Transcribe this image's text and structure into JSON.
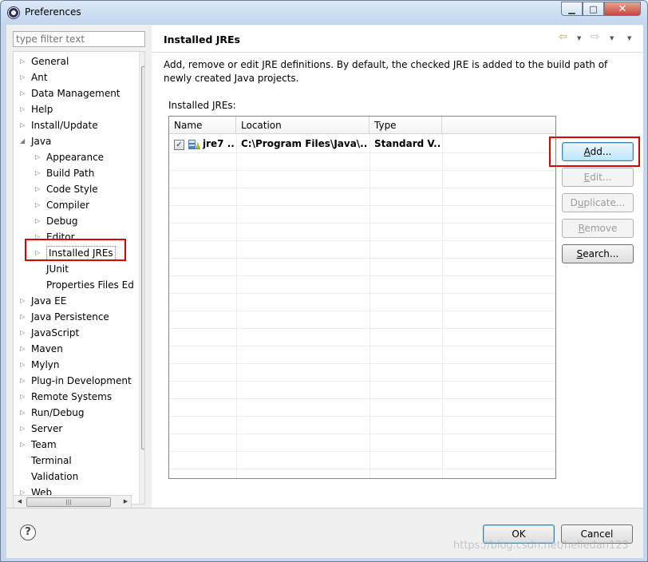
{
  "window": {
    "title": "Preferences"
  },
  "filter": {
    "placeholder": "type filter text"
  },
  "tree": {
    "items": [
      {
        "label": "General",
        "level": 0,
        "expand": "collapsed"
      },
      {
        "label": "Ant",
        "level": 0,
        "expand": "collapsed"
      },
      {
        "label": "Data Management",
        "level": 0,
        "expand": "collapsed"
      },
      {
        "label": "Help",
        "level": 0,
        "expand": "collapsed"
      },
      {
        "label": "Install/Update",
        "level": 0,
        "expand": "collapsed"
      },
      {
        "label": "Java",
        "level": 0,
        "expand": "expanded"
      },
      {
        "label": "Appearance",
        "level": 1,
        "expand": "collapsed"
      },
      {
        "label": "Build Path",
        "level": 1,
        "expand": "collapsed"
      },
      {
        "label": "Code Style",
        "level": 1,
        "expand": "collapsed"
      },
      {
        "label": "Compiler",
        "level": 1,
        "expand": "collapsed"
      },
      {
        "label": "Debug",
        "level": 1,
        "expand": "collapsed"
      },
      {
        "label": "Editor",
        "level": 1,
        "expand": "collapsed"
      },
      {
        "label": "Installed JREs",
        "level": 1,
        "expand": "collapsed",
        "selected": true
      },
      {
        "label": "JUnit",
        "level": 1,
        "expand": "none"
      },
      {
        "label": "Properties Files Ed",
        "level": 1,
        "expand": "none"
      },
      {
        "label": "Java EE",
        "level": 0,
        "expand": "collapsed"
      },
      {
        "label": "Java Persistence",
        "level": 0,
        "expand": "collapsed"
      },
      {
        "label": "JavaScript",
        "level": 0,
        "expand": "collapsed"
      },
      {
        "label": "Maven",
        "level": 0,
        "expand": "collapsed"
      },
      {
        "label": "Mylyn",
        "level": 0,
        "expand": "collapsed"
      },
      {
        "label": "Plug-in Development",
        "level": 0,
        "expand": "collapsed"
      },
      {
        "label": "Remote Systems",
        "level": 0,
        "expand": "collapsed"
      },
      {
        "label": "Run/Debug",
        "level": 0,
        "expand": "collapsed"
      },
      {
        "label": "Server",
        "level": 0,
        "expand": "collapsed"
      },
      {
        "label": "Team",
        "level": 0,
        "expand": "collapsed"
      },
      {
        "label": "Terminal",
        "level": 0,
        "expand": "none"
      },
      {
        "label": "Validation",
        "level": 0,
        "expand": "none"
      },
      {
        "label": "Web",
        "level": 0,
        "expand": "collapsed"
      }
    ]
  },
  "page": {
    "title": "Installed JREs",
    "description": "Add, remove or edit JRE definitions. By default, the checked JRE is added to the build path of newly created Java projects.",
    "table_label": "Installed JREs:",
    "columns": [
      "Name",
      "Location",
      "Type"
    ],
    "rows": [
      {
        "checked": true,
        "name": "jre7 ...",
        "location": "C:\\Program Files\\Java\\...",
        "type": "Standard V..."
      }
    ],
    "buttons": {
      "add": "Add...",
      "edit": "Edit...",
      "duplicate": "Duplicate...",
      "remove": "Remove",
      "search": "Search..."
    }
  },
  "footer": {
    "ok": "OK",
    "cancel": "Cancel"
  },
  "watermark": "https://blog.csdn.net/heliedan123",
  "colors": {
    "highlight_red": "#e00000",
    "focus_blue": "#3c7fb1"
  }
}
